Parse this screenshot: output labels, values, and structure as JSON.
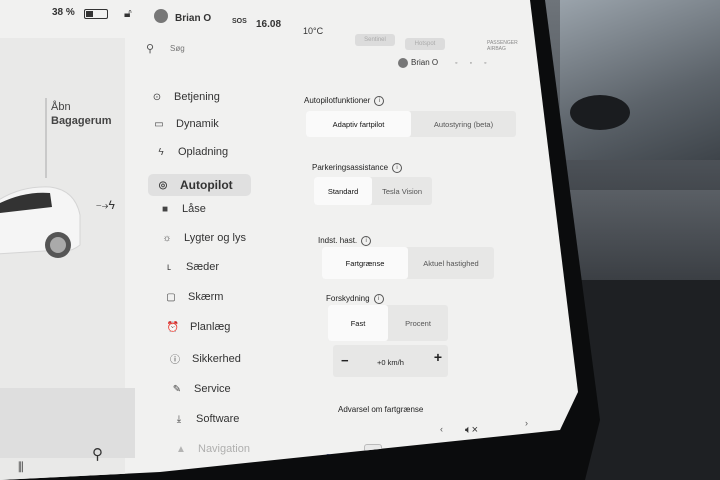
{
  "status": {
    "battery_percent": "38 %",
    "user": "Brian O",
    "sos": "SOS",
    "time": "16.08",
    "temperature": "10°C",
    "blurred_1": "Sentinel",
    "blurred_2": "Hotspot",
    "blurred_3": "PASSENGER AIRBAG"
  },
  "left": {
    "trunk_open": "Åbn",
    "trunk_label": "Bagagerum"
  },
  "search": {
    "placeholder": "Søg"
  },
  "top_user": "Brian O",
  "menu": [
    {
      "label": "Betjening",
      "icon": "toggle-icon",
      "glyph": "⊙"
    },
    {
      "label": "Dynamik",
      "icon": "car-icon",
      "glyph": "▭"
    },
    {
      "label": "Opladning",
      "icon": "bolt-icon",
      "glyph": "ϟ"
    },
    {
      "label": "Autopilot",
      "icon": "steering-wheel-icon",
      "glyph": "◎",
      "active": true
    },
    {
      "label": "Låse",
      "icon": "lock-icon",
      "glyph": "■"
    },
    {
      "label": "Lygter og lys",
      "icon": "sun-icon",
      "glyph": "☼"
    },
    {
      "label": "Sæder",
      "icon": "seat-icon",
      "glyph": "ʟ"
    },
    {
      "label": "Skærm",
      "icon": "display-icon",
      "glyph": "▢"
    },
    {
      "label": "Planlæg",
      "icon": "clock-icon",
      "glyph": "⏰"
    },
    {
      "label": "Sikkerhed",
      "icon": "info-icon",
      "glyph": "ⓘ"
    },
    {
      "label": "Service",
      "icon": "wrench-icon",
      "glyph": "✎"
    },
    {
      "label": "Software",
      "icon": "download-icon",
      "glyph": "⤓"
    },
    {
      "label": "Navigation",
      "icon": "navigation-icon",
      "glyph": "▲"
    }
  ],
  "settings": {
    "autopilot_features": {
      "label": "Autopilotfunktioner",
      "options": [
        "Adaptiv fartpilot",
        "Autostyring (beta)"
      ],
      "selected": 0
    },
    "parking": {
      "label": "Parkeringsassistance",
      "options": [
        "Standard",
        "Tesla Vision"
      ],
      "selected": 0
    },
    "speed_set": {
      "label": "Indst. hast.",
      "options": [
        "Fartgrænse",
        "Aktuel hastighed"
      ],
      "selected": 0
    },
    "offset": {
      "label": "Forskydning",
      "options": [
        "Fast",
        "Procent"
      ],
      "selected": 0,
      "value": "+0 km/h",
      "minus": "−",
      "plus": "+"
    },
    "footer": "Advarsel om fartgrænse"
  },
  "taskbar": {
    "dots": "•••",
    "info": "i"
  }
}
